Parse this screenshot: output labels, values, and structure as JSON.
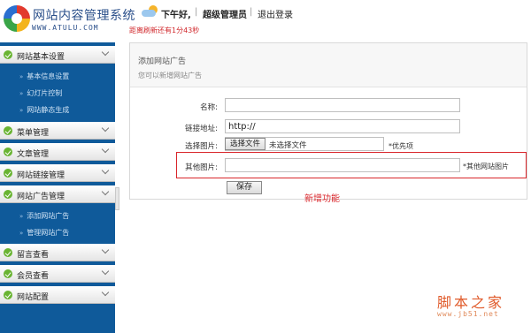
{
  "header": {
    "logo_title": "网站内容管理系统",
    "logo_url": "WWW.ATULU.COM",
    "greeting": "下午好,",
    "separator": "|",
    "role": "超级管理员",
    "logout": "退出登录",
    "refresh_text": "距离刷新还有1分43秒"
  },
  "sidebar": {
    "groups": [
      {
        "label": "网站基本设置"
      },
      {
        "label": "菜单管理"
      },
      {
        "label": "文章管理"
      },
      {
        "label": "网站链接管理"
      },
      {
        "label": "网站广告管理"
      },
      {
        "label": "留言查看"
      },
      {
        "label": "会员查看"
      },
      {
        "label": "网站配置"
      }
    ],
    "subitems_basic": [
      "基本信息设置",
      "幻灯片控制",
      "网站静态生成"
    ],
    "subitems_ads": [
      "添加网站广告",
      "管理网站广告"
    ]
  },
  "panel": {
    "title": "添加网站广告",
    "subtitle": "您可以新增网站广告",
    "name_label": "名称:",
    "name_value": "",
    "link_label": "链接地址:",
    "link_value": "http://",
    "image_label": "选择图片:",
    "file_button": "选择文件",
    "file_status": "未选择文件",
    "image_note": "*优先项",
    "other_label": "其他图片:",
    "other_value": "",
    "other_note": "*其他网站图片",
    "save_button": "保存",
    "new_feature": "新增功能"
  },
  "watermark": {
    "main": "脚本之家",
    "url": "www.jb51.net"
  },
  "colors": {
    "sidebar_bg": "#0f5a9a",
    "highlight": "#d9262b",
    "check_green": "#69b432"
  }
}
